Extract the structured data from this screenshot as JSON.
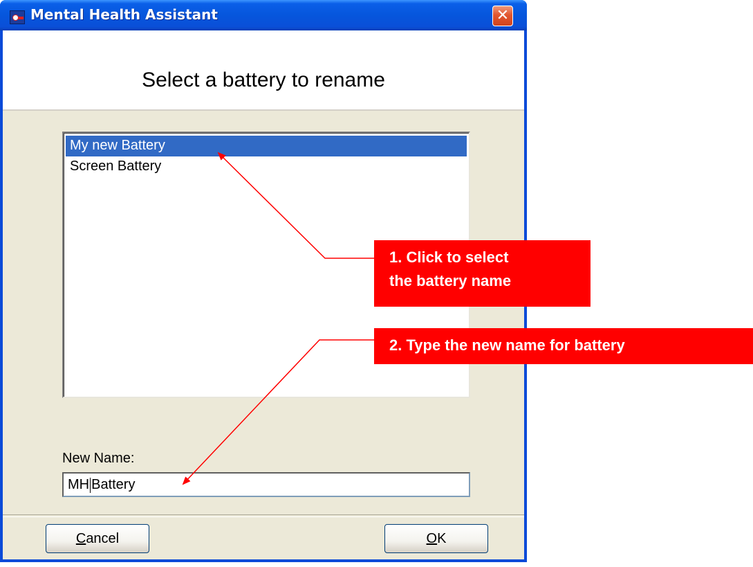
{
  "window": {
    "title": "Mental Health Assistant",
    "close_glyph": "✕"
  },
  "dialog": {
    "heading": "Select a battery to rename",
    "list_items": [
      "My new Battery",
      "Screen Battery"
    ],
    "selected_index": 0,
    "new_name_label": "New Name:",
    "new_name_value_before_caret": "MH",
    "new_name_value_after_caret": "Battery",
    "cancel_label_prefix": "",
    "cancel_label_access_key": "C",
    "cancel_label_rest": "ancel",
    "ok_label_access_key": "O",
    "ok_label_rest": "K"
  },
  "annotations": {
    "step1_line1": "1. Click to select",
    "step1_line2": "the battery  name",
    "step2": "2. Type the new name  for battery",
    "callout_color": "#ff0000"
  },
  "colors": {
    "title_bar": "#0656dc",
    "selection": "#316ac5",
    "dialog_bg": "#ece9d8"
  }
}
